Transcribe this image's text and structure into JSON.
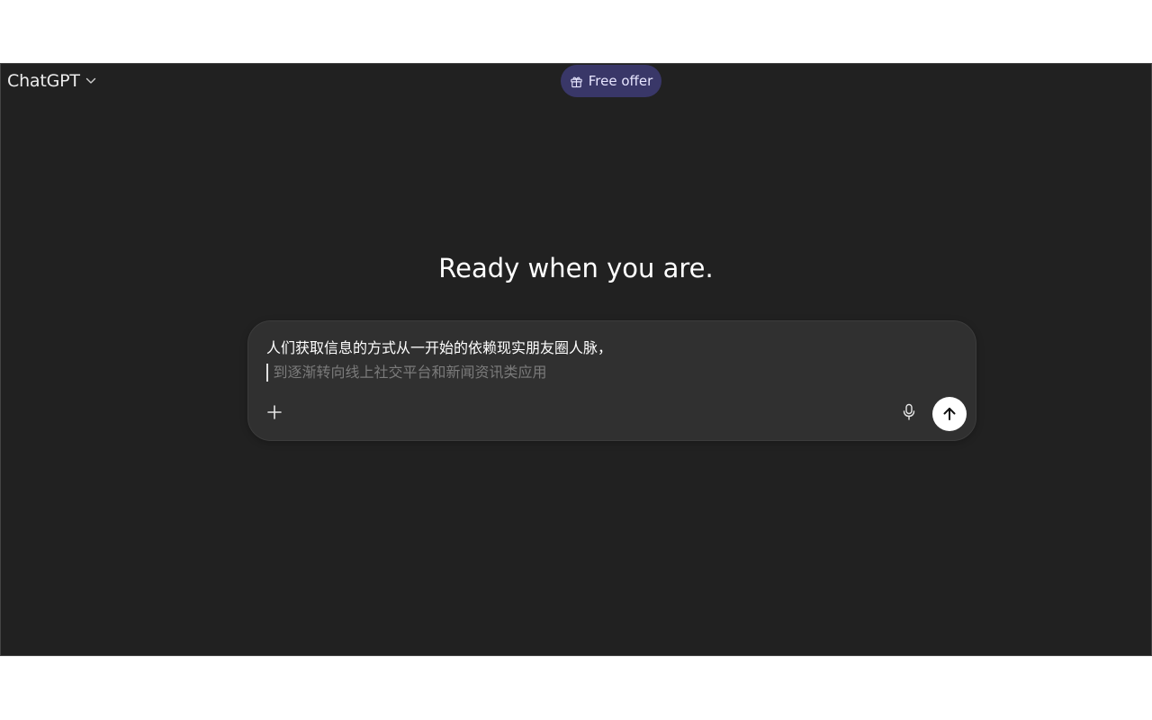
{
  "header": {
    "model_name": "ChatGPT",
    "model_menu_icon": "chevron-down-icon",
    "offer": {
      "label": "Free offer",
      "icon": "gift-icon",
      "background": "#393768"
    }
  },
  "main": {
    "headline": "Ready when you are."
  },
  "composer": {
    "typed_line_1": "人们获取信息的方式从一开始的依赖现实朋友圈人脉，",
    "suggestion_line_2": "到逐渐转向线上社交平台和新闻资讯类应用",
    "buttons": {
      "attach_icon": "plus-icon",
      "voice_icon": "microphone-icon",
      "send_icon": "arrow-up-icon"
    }
  },
  "colors": {
    "app_background": "#212121",
    "composer_background": "#303030",
    "send_button": "#ffffff"
  }
}
